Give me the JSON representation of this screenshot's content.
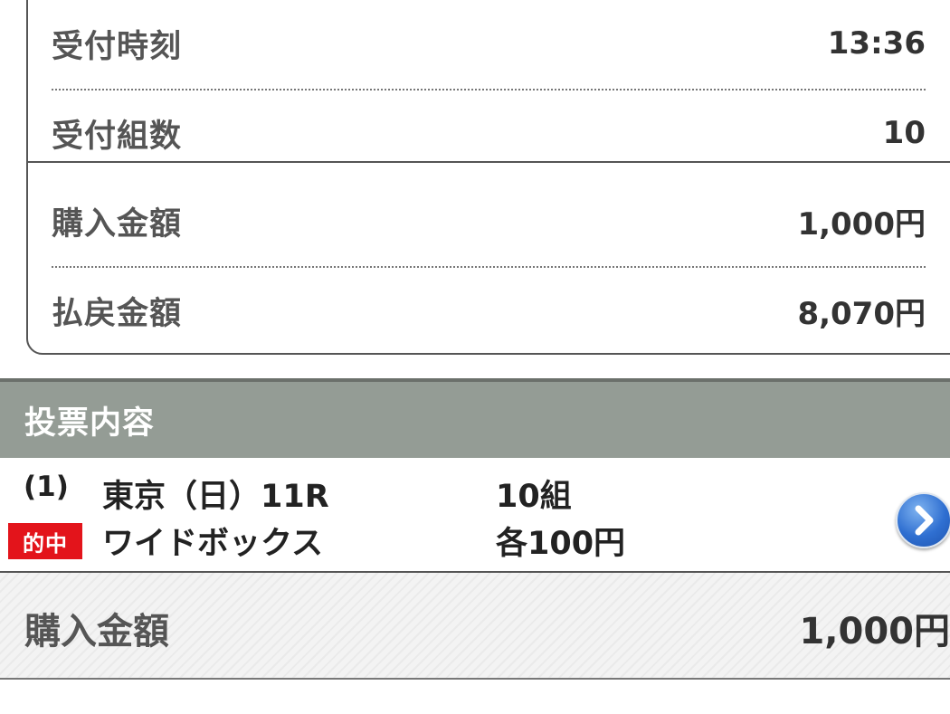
{
  "summary": {
    "rows": [
      {
        "label": "受付時刻",
        "value": "13:36"
      },
      {
        "label": "受付組数",
        "value": "10"
      },
      {
        "label": "購入金額",
        "value": "1,000円"
      },
      {
        "label": "払戻金額",
        "value": "8,070円"
      }
    ]
  },
  "section": {
    "title": "投票内容"
  },
  "bet": {
    "number": "(1)",
    "hit_badge": "的中",
    "race": "東京（日）11R",
    "bet_type": "ワイドボックス",
    "combinations": "10組",
    "amount_each": "各100円",
    "detail_icon": "chevron-right-icon"
  },
  "total": {
    "label": "購入金額",
    "value": "1,000円"
  },
  "colors": {
    "section_header_bg": "#949c95",
    "hit_badge_bg": "#e3141b",
    "detail_button": "#2f6fd1"
  }
}
